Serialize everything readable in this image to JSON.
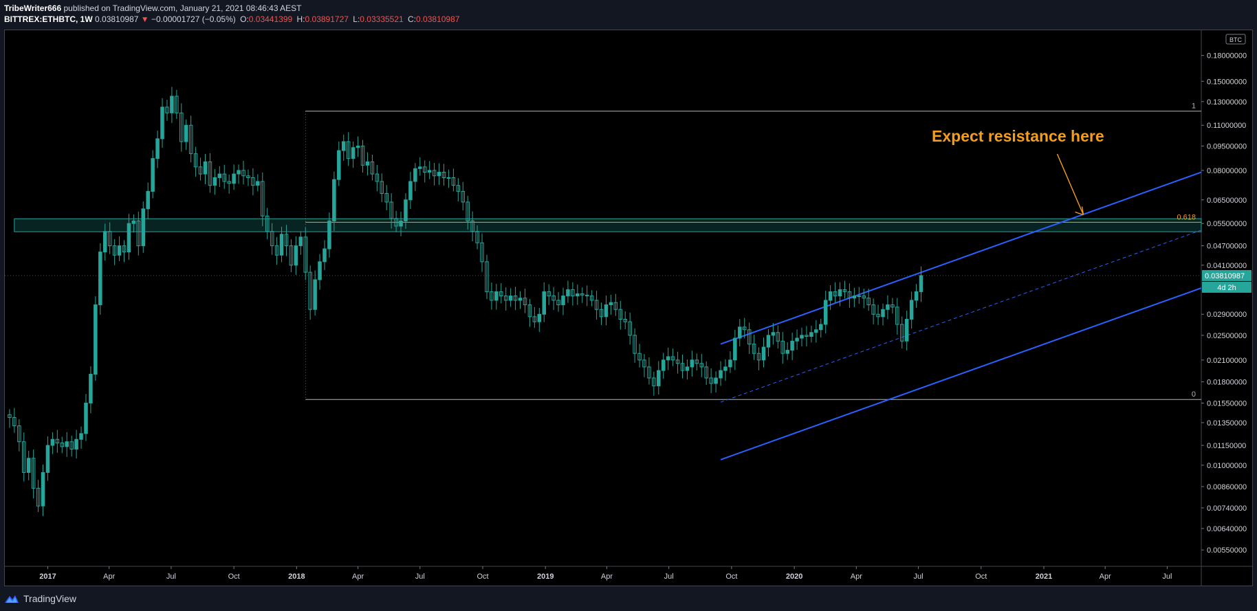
{
  "header": {
    "author": "TribeWriter666",
    "published_text": "published on TradingView.com, January 21, 2021 08:46:43 AEST",
    "symbol": "BITTREX:ETHBTC, 1W",
    "last": "0.03810987",
    "change": "−0.00001727 (−0.05%)",
    "o_label": "O:",
    "o_value": "0.03441399",
    "h_label": "H:",
    "h_value": "0.03891727",
    "l_label": "L:",
    "l_value": "0.03335521",
    "c_label": "C:",
    "c_value": "0.03810987"
  },
  "footer": {
    "brand": "TradingView",
    "logo_icon": "tradingview-logo-icon"
  },
  "chart_data": {
    "type": "candlestick",
    "symbol": "BITTREX:ETHBTC",
    "interval": "1W",
    "currency_label": "BTC",
    "log_scale": true,
    "ylim": [
      0.0049,
      0.215
    ],
    "colors": {
      "up": "#26a69a",
      "down": "#26a69a",
      "background": "#000000",
      "channel": "#2962ff",
      "fib": "#b2b5be",
      "fib618": "#f59d1c",
      "annotation": "#f59d1c",
      "zone": "#26a69a"
    },
    "y_ticks": [
      "0.18000000",
      "0.15000000",
      "0.13000000",
      "0.11000000",
      "0.09500000",
      "0.08000000",
      "0.06500000",
      "0.05500000",
      "0.04700000",
      "0.04100000",
      "0.02900000",
      "0.02500000",
      "0.02100000",
      "0.01800000",
      "0.01550000",
      "0.01350000",
      "0.01150000",
      "0.01000000",
      "0.00860000",
      "0.00740000",
      "0.00640000",
      "0.00550000"
    ],
    "y_tick_values": [
      0.18,
      0.15,
      0.13,
      0.11,
      0.095,
      0.08,
      0.065,
      0.055,
      0.047,
      0.041,
      0.029,
      0.025,
      0.021,
      0.018,
      0.0155,
      0.0135,
      0.0115,
      0.01,
      0.0086,
      0.0074,
      0.0064,
      0.0055
    ],
    "x_ticks": [
      {
        "label": "2017",
        "date": "2017-01-01",
        "bold": true
      },
      {
        "label": "Apr",
        "date": "2017-04-01"
      },
      {
        "label": "Jul",
        "date": "2017-07-01"
      },
      {
        "label": "Oct",
        "date": "2017-10-01"
      },
      {
        "label": "2018",
        "date": "2018-01-01",
        "bold": true
      },
      {
        "label": "Apr",
        "date": "2018-04-01"
      },
      {
        "label": "Jul",
        "date": "2018-07-01"
      },
      {
        "label": "Oct",
        "date": "2018-10-01"
      },
      {
        "label": "2019",
        "date": "2019-01-01",
        "bold": true
      },
      {
        "label": "Apr",
        "date": "2019-04-01"
      },
      {
        "label": "Jul",
        "date": "2019-07-01"
      },
      {
        "label": "Oct",
        "date": "2019-10-01"
      },
      {
        "label": "2020",
        "date": "2020-01-01",
        "bold": true
      },
      {
        "label": "Apr",
        "date": "2020-04-01"
      },
      {
        "label": "Jul",
        "date": "2020-07-01"
      },
      {
        "label": "Oct",
        "date": "2020-10-01"
      },
      {
        "label": "2021",
        "date": "2021-01-01",
        "bold": true
      },
      {
        "label": "Apr",
        "date": "2021-04-01"
      },
      {
        "label": "Jul",
        "date": "2021-07-01"
      }
    ],
    "x_range": [
      "2016-10-30",
      "2021-08-20"
    ],
    "series": [
      {
        "start_date": "2016-11-06",
        "close": [
          0.014,
          0.0132,
          0.0118,
          0.0095,
          0.0105,
          0.0085,
          0.0075,
          0.0095,
          0.0115,
          0.012,
          0.0117,
          0.0114,
          0.0118,
          0.0112,
          0.012,
          0.0125,
          0.0155,
          0.019,
          0.031,
          0.045,
          0.052,
          0.047,
          0.044,
          0.047,
          0.045,
          0.055,
          0.056,
          0.047,
          0.061,
          0.069,
          0.087,
          0.1,
          0.125,
          0.12,
          0.135,
          0.12,
          0.098,
          0.11,
          0.09,
          0.082,
          0.078,
          0.085,
          0.072,
          0.076,
          0.078,
          0.074,
          0.073,
          0.078,
          0.08,
          0.077,
          0.076,
          0.072,
          0.074,
          0.058,
          0.052,
          0.047,
          0.044,
          0.051,
          0.047,
          0.041,
          0.047,
          0.05,
          0.039,
          0.03,
          0.037,
          0.042,
          0.046,
          0.056,
          0.075,
          0.092,
          0.098,
          0.087,
          0.094,
          0.095,
          0.083,
          0.085,
          0.078,
          0.074,
          0.068,
          0.064,
          0.057,
          0.054,
          0.056,
          0.065,
          0.074,
          0.081,
          0.082,
          0.079,
          0.08,
          0.077,
          0.079,
          0.076,
          0.076,
          0.072,
          0.069,
          0.064,
          0.056,
          0.052,
          0.048,
          0.042,
          0.034,
          0.032,
          0.034,
          0.033,
          0.032,
          0.033,
          0.032,
          0.0325,
          0.031,
          0.0285,
          0.0275,
          0.029,
          0.034,
          0.033,
          0.032,
          0.031,
          0.033,
          0.0345,
          0.033,
          0.0335,
          0.0332,
          0.033,
          0.032,
          0.03,
          0.0285,
          0.031,
          0.0315,
          0.03,
          0.028,
          0.0275,
          0.025,
          0.022,
          0.021,
          0.02,
          0.0185,
          0.0175,
          0.0195,
          0.021,
          0.0215,
          0.021,
          0.0205,
          0.0195,
          0.02,
          0.021,
          0.0205,
          0.02,
          0.0185,
          0.0178,
          0.0185,
          0.0195,
          0.02,
          0.021,
          0.0245,
          0.0265,
          0.026,
          0.0235,
          0.022,
          0.021,
          0.023,
          0.025,
          0.0255,
          0.024,
          0.022,
          0.0225,
          0.024,
          0.0245,
          0.025,
          0.0248,
          0.0255,
          0.026,
          0.027,
          0.032,
          0.034,
          0.033,
          0.0345,
          0.034,
          0.0325,
          0.033,
          0.033,
          0.0325,
          0.031,
          0.029,
          0.0285,
          0.03,
          0.031,
          0.0305,
          0.027,
          0.024,
          0.028,
          0.032,
          0.034,
          0.0381
        ]
      }
    ],
    "last_price_label": "0.03810987",
    "countdown_label": "4d 2h",
    "drawings": {
      "fib_levels": [
        {
          "label": "1",
          "value": 0.1215
        },
        {
          "label": "0.618",
          "value": 0.0555
        },
        {
          "label": "0",
          "value": 0.0159
        }
      ],
      "fib_start_date": "2018-01-14",
      "zone": {
        "from": 0.0519,
        "to": 0.0569,
        "start_date": "2016-11-13"
      },
      "channel": {
        "upper": [
          {
            "date": "2019-09-15",
            "value": 0.0235
          },
          {
            "date": "2021-08-20",
            "value": 0.079
          }
        ],
        "lower": [
          {
            "date": "2019-09-15",
            "value": 0.0104
          },
          {
            "date": "2021-08-20",
            "value": 0.0349
          }
        ],
        "mid": [
          {
            "date": "2019-09-15",
            "value": 0.0156
          },
          {
            "date": "2021-08-20",
            "value": 0.0525
          }
        ]
      },
      "annotation": {
        "text": "Expect resistance here"
      }
    }
  }
}
